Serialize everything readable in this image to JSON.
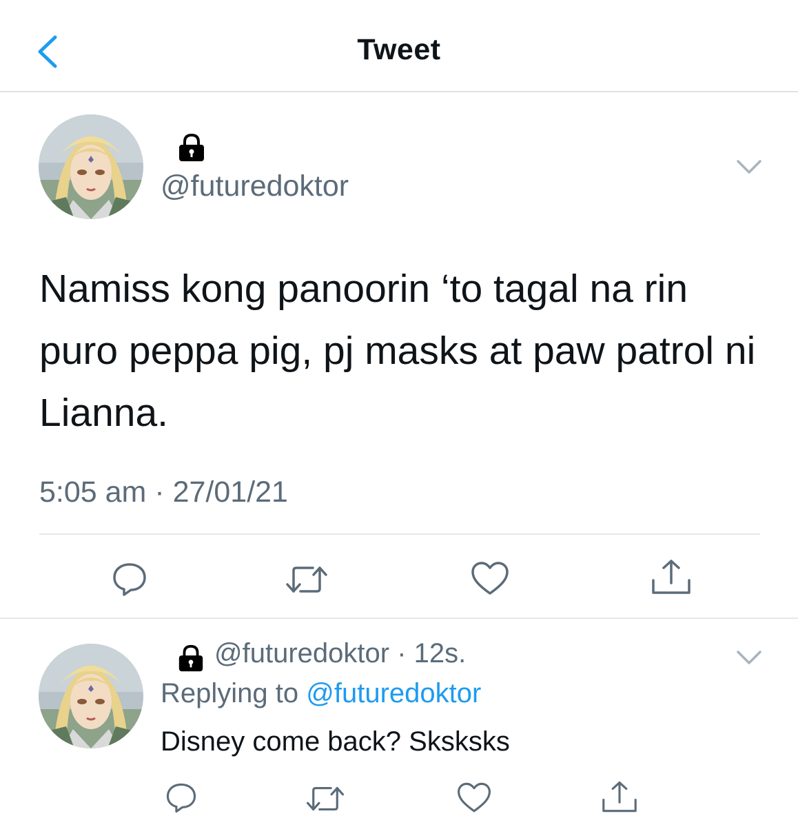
{
  "header": {
    "title": "Tweet",
    "back_icon": "chevron-left-icon",
    "accent_color": "#1d9bf0"
  },
  "tweet": {
    "handle": "@futuredoktor",
    "protected_icon": "lock-icon",
    "body": "Namiss kong panoorin ‘to tagal na rin puro peppa pig, pj masks at paw patrol ni Lianna.",
    "timestamp": "5:05 am · 27/01/21",
    "actions": [
      "reply-icon",
      "retweet-icon",
      "like-icon",
      "share-icon"
    ]
  },
  "reply": {
    "handle": "@futuredoktor",
    "time": "· 12s.",
    "replying_prefix": "Replying to",
    "replying_to": "@futuredoktor",
    "text": "Disney come back? Sksksks",
    "actions": [
      "reply-icon",
      "retweet-icon",
      "like-icon",
      "share-icon"
    ]
  }
}
